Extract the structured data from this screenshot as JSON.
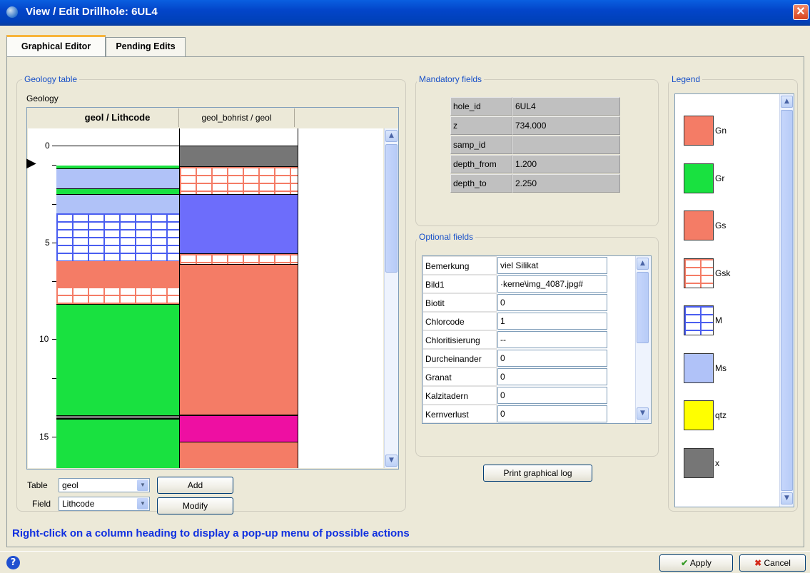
{
  "window": {
    "title": "View / Edit Drillhole: 6UL4",
    "close_symbol": "✕"
  },
  "tabs": [
    {
      "label": "Graphical Editor",
      "active": true
    },
    {
      "label": "Pending Edits",
      "active": false
    }
  ],
  "geology_table": {
    "group_title": "Geology table",
    "table_label": "Geology",
    "columns": [
      "geol / Lithcode",
      "geol_bohrist / geol"
    ],
    "depth_ticks": [
      "0",
      "5",
      "10",
      "15"
    ],
    "row_marker": "▶"
  },
  "controls": {
    "table_label": "Table",
    "table_value": "geol",
    "field_label": "Field",
    "field_value": "Lithcode",
    "add_button": "Add",
    "modify_button": "Modify"
  },
  "mandatory": {
    "group_title": "Mandatory fields",
    "rows": [
      {
        "name": "hole_id",
        "value": "6UL4"
      },
      {
        "name": "z",
        "value": "734.000"
      },
      {
        "name": "samp_id",
        "value": ""
      },
      {
        "name": "depth_from",
        "value": "1.200"
      },
      {
        "name": "depth_to",
        "value": "2.250"
      }
    ]
  },
  "optional": {
    "group_title": "Optional fields",
    "rows": [
      {
        "name": "Bemerkung",
        "value": "viel Silikat"
      },
      {
        "name": "Bild1",
        "value": "·kerne\\img_4087.jpg#"
      },
      {
        "name": "Biotit",
        "value": "0"
      },
      {
        "name": "Chlorcode",
        "value": "1"
      },
      {
        "name": "Chloritisierung",
        "value": "--"
      },
      {
        "name": "Durcheinander",
        "value": "0"
      },
      {
        "name": "Granat",
        "value": "0"
      },
      {
        "name": "Kalzitadern",
        "value": "0"
      },
      {
        "name": "Kernverlust",
        "value": "0"
      }
    ]
  },
  "print_button": "Print graphical log",
  "legend": {
    "group_title": "Legend",
    "items": [
      {
        "code": "Gn",
        "color": "#f47c66",
        "pattern": "solid"
      },
      {
        "code": "Gr",
        "color": "#19e140",
        "pattern": "solid"
      },
      {
        "code": "Gs",
        "color": "#f47c66",
        "pattern": "solid"
      },
      {
        "code": "Gsk",
        "color": "#f47c66",
        "pattern": "brick"
      },
      {
        "code": "M",
        "color": "#4a5ef0",
        "pattern": "brick"
      },
      {
        "code": "Ms",
        "color": "#b0c2f8",
        "pattern": "solid"
      },
      {
        "code": "qtz",
        "color": "#ffff00",
        "pattern": "solid"
      },
      {
        "code": "x",
        "color": "#767676",
        "pattern": "solid"
      }
    ]
  },
  "hint": "Right-click on a column heading to display a pop-up menu of possible actions",
  "footer": {
    "help_symbol": "?",
    "apply_button": "Apply",
    "cancel_button": "Cancel"
  }
}
